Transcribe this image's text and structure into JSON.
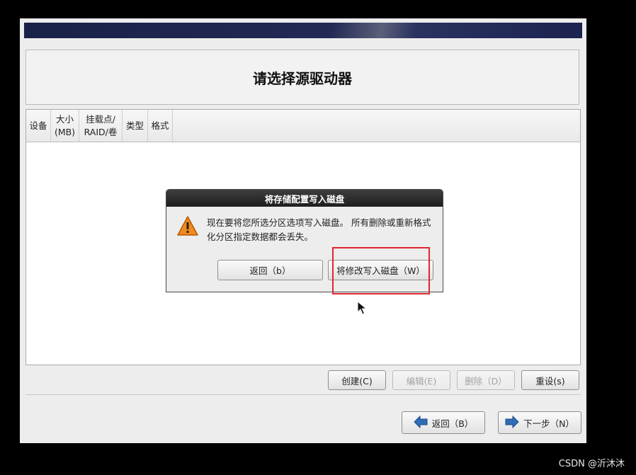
{
  "page": {
    "title": "请选择源驱动器"
  },
  "table": {
    "columns": [
      {
        "line1": "设备",
        "line2": ""
      },
      {
        "line1": "大小",
        "line2": "(MB)"
      },
      {
        "line1": "挂载点/",
        "line2": "RAID/卷"
      },
      {
        "line1": "类型",
        "line2": ""
      },
      {
        "line1": "格式",
        "line2": ""
      }
    ]
  },
  "actions": {
    "create": "创建(C)",
    "edit": "编辑(E)",
    "delete": "删除（D）",
    "reset": "重设(s)"
  },
  "nav": {
    "back": "返回（B）",
    "next": "下一步（N）"
  },
  "dialog": {
    "title": "将存储配置写入磁盘",
    "message": "现在要将您所选分区选项写入磁盘。 所有删除或重新格式化分区指定数据都会丢失。",
    "back_button": "返回（b）",
    "write_button": "将修改写入磁盘（W）"
  },
  "watermark": "CSDN @沂沐沐",
  "colors": {
    "highlight": "#e0262d",
    "banner": "#1e2550",
    "warning": "#f28a1c",
    "nav_arrow": "#2e6db5"
  }
}
